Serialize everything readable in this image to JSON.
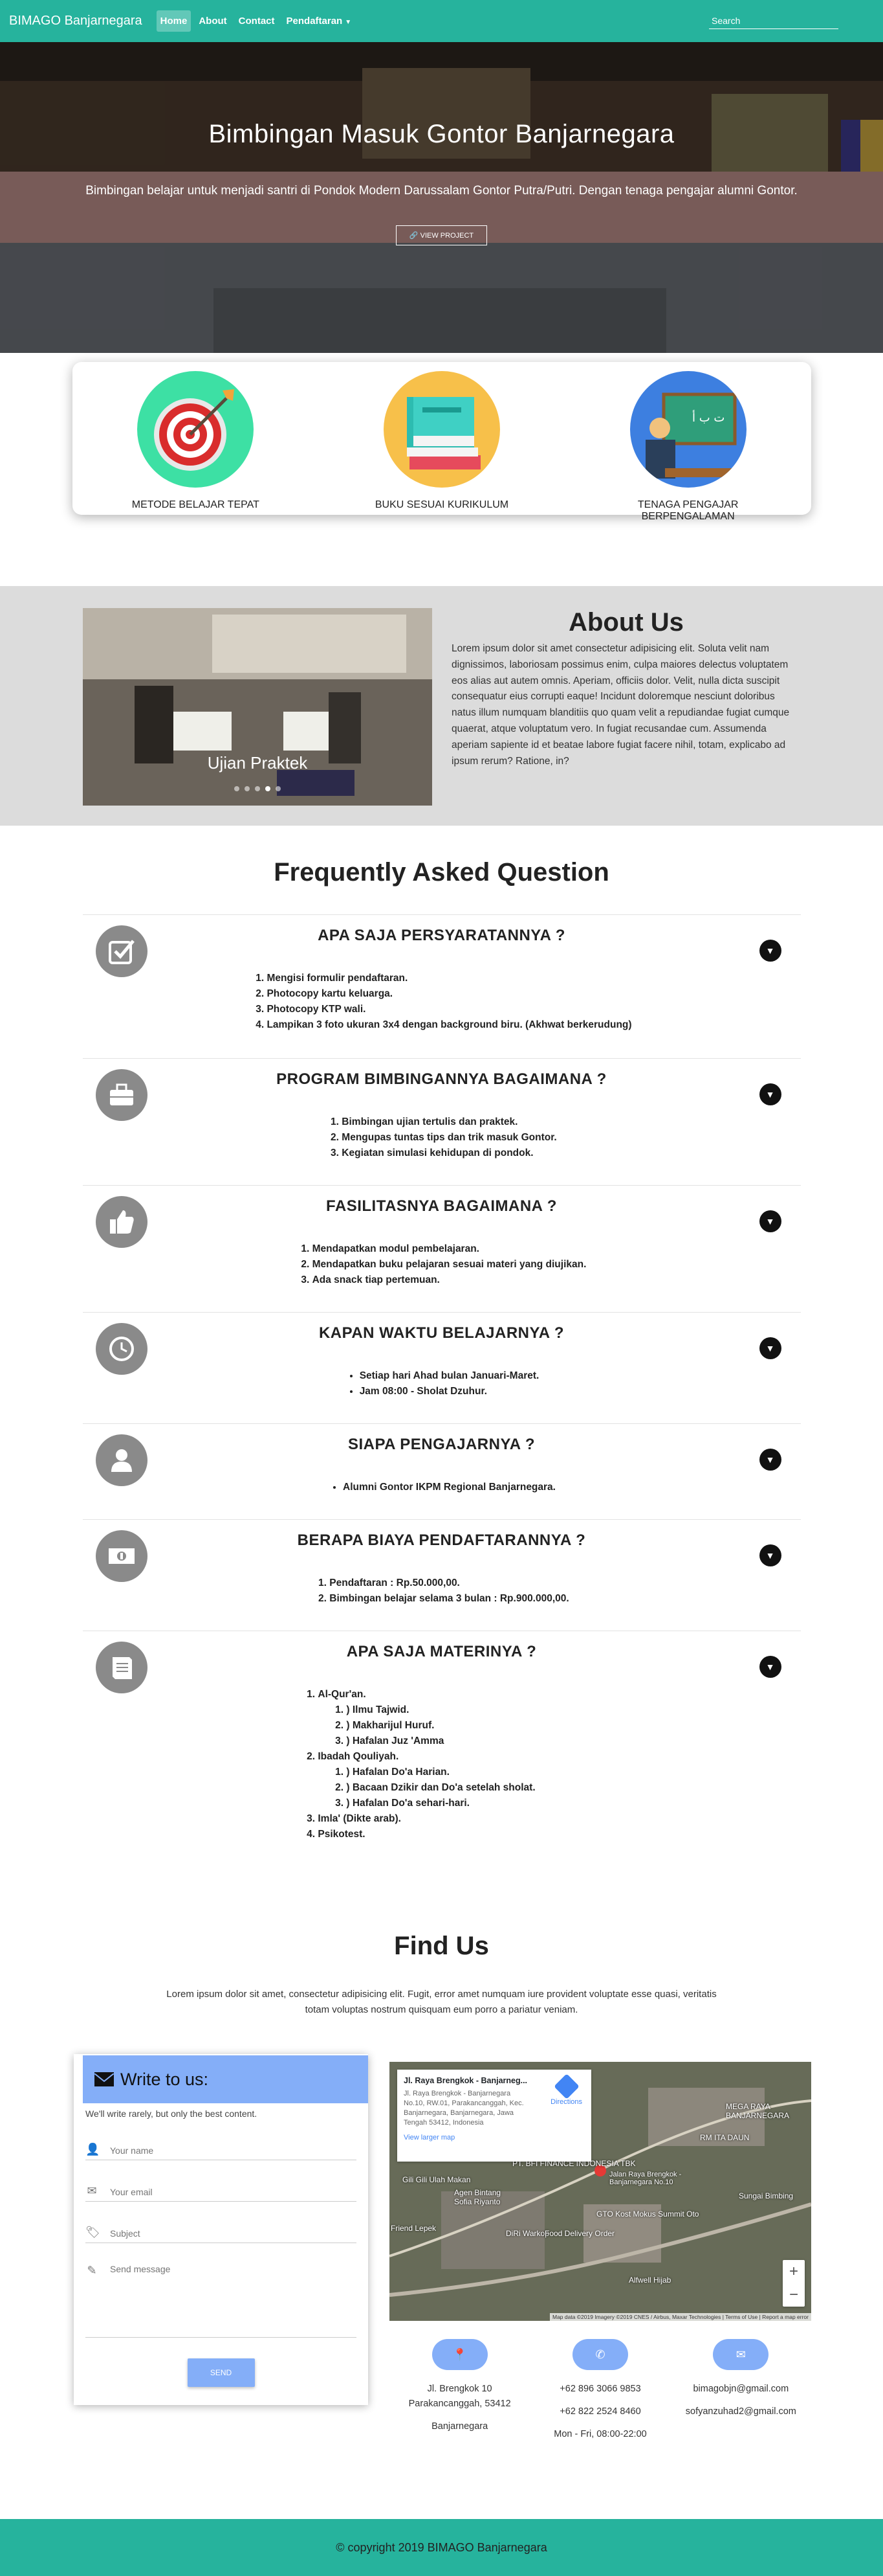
{
  "nav": {
    "brand": "BIMAGO Banjarnegara",
    "items": [
      "Home",
      "About",
      "Contact",
      "Pendaftaran"
    ],
    "search_placeholder": "Search"
  },
  "hero": {
    "title": "Bimbingan Masuk Gontor Banjarnegara",
    "subtitle": "Bimbingan belajar untuk menjadi santri di Pondok Modern Darussalam Gontor Putra/Putri. Dengan tenaga pengajar alumni Gontor.",
    "button": "VIEW PROJECT"
  },
  "features": [
    {
      "label": "METODE BELAJAR TEPAT",
      "icon": "target-icon",
      "color": "#3de0a4"
    },
    {
      "label": "BUKU SESUAI KURIKULUM",
      "icon": "books-icon",
      "color": "#f7c04a"
    },
    {
      "label": "TENAGA PENGAJAR BERPENGALAMAN",
      "icon": "teacher-icon",
      "color": "#3d7fe0"
    }
  ],
  "about": {
    "title": "About Us",
    "body": "Lorem ipsum dolor sit amet consectetur adipisicing elit. Soluta velit nam dignissimos, laboriosam possimus enim, culpa maiores delectus voluptatem eos alias aut autem omnis. Aperiam, officiis dolor. Velit, nulla dicta suscipit consequatur eius corrupti eaque! Incidunt doloremque nesciunt doloribus natus illum numquam blanditiis quo quam velit a repudiandae fugiat cumque quaerat, atque voluptatum vero. In fugiat recusandae cum. Assumenda aperiam sapiente id et beatae labore fugiat facere nihil, totam, explicabo ad ipsum rerum? Ratione, in?",
    "carousel_caption": "Ujian Praktek",
    "carousel_slides": 5,
    "carousel_active": 4
  },
  "faq": {
    "title": "Frequently Asked Question",
    "items": [
      {
        "q": "APA SAJA PERSYARATANNYA ?",
        "icon": "checkbox-icon",
        "list": "ol",
        "a": [
          "Mengisi formulir pendaftaran.",
          "Photocopy kartu keluarga.",
          "Photocopy KTP wali.",
          "Lampikan 3 foto ukuran 3x4 dengan background biru. (Akhwat berkerudung)"
        ]
      },
      {
        "q": "PROGRAM BIMBINGANNYA BAGAIMANA ?",
        "icon": "briefcase-icon",
        "list": "ol",
        "a": [
          "Bimbingan ujian tertulis dan praktek.",
          "Mengupas tuntas tips dan trik masuk Gontor.",
          "Kegiatan simulasi kehidupan di pondok."
        ]
      },
      {
        "q": "FASILITASNYA BAGAIMANA ?",
        "icon": "thumbs-up-icon",
        "list": "ol",
        "a": [
          "Mendapatkan modul pembelajaran.",
          "Mendapatkan buku pelajaran sesuai materi yang diujikan.",
          "Ada snack tiap pertemuan."
        ]
      },
      {
        "q": "KAPAN WAKTU BELAJARNYA ?",
        "icon": "clock-icon",
        "list": "ul",
        "a": [
          "Setiap hari Ahad bulan Januari-Maret.",
          "Jam 08:00 - Sholat Dzuhur."
        ]
      },
      {
        "q": "SIAPA PENGAJARNYA ?",
        "icon": "user-icon",
        "list": "ul",
        "a": [
          "Alumni Gontor IKPM Regional Banjarnegara."
        ]
      },
      {
        "q": "BERAPA BIAYA PENDAFTARANNYA ?",
        "icon": "money-icon",
        "list": "ol",
        "a": [
          "Pendaftaran : Rp.50.000,00.",
          "Bimbingan belajar selama 3 bulan : Rp.900.000,00."
        ]
      },
      {
        "q": "APA SAJA MATERINYA ?",
        "icon": "book-icon",
        "list": "nested",
        "a": [
          {
            "text": "Al-Qur'an.",
            "sub": [
              ") Ilmu Tajwid.",
              ") Makharijul Huruf.",
              ") Hafalan Juz 'Amma"
            ]
          },
          {
            "text": "Ibadah Qouliyah.",
            "sub": [
              ") Hafalan Do'a Harian.",
              ") Bacaan Dzikir dan Do'a setelah sholat.",
              ") Hafalan Do'a sehari-hari."
            ]
          },
          {
            "text": "Imla' (Dikte arab).",
            "sub": []
          },
          {
            "text": "Psikotest.",
            "sub": []
          }
        ]
      }
    ]
  },
  "findus": {
    "title": "Find Us",
    "desc": "Lorem ipsum dolor sit amet, consectetur adipisicing elit. Fugit, error amet numquam iure provident voluptate esse quasi, veritatis totam voluptas nostrum quisquam eum porro a pariatur veniam.",
    "form": {
      "header": "Write to us:",
      "note": "We'll write rarely, but only the best content.",
      "name_placeholder": "Your name",
      "email_placeholder": "Your email",
      "subject_placeholder": "Subject",
      "message_placeholder": "Send message",
      "send": "SEND"
    },
    "map": {
      "card_title": "Jl. Raya Brengkok - Banjarneg...",
      "card_addr": "Jl. Raya Brengkok - Banjarnegara No.10, RW.01, Parakancanggah, Kec. Banjarnegara, Banjarnegara, Jawa Tengah 53412, Indonesia",
      "directions": "Directions",
      "larger": "View larger map",
      "attribution": "Map data ©2019 Imagery ©2019 CNES / Airbus, Maxar Technologies  |  Terms of Use  |  Report a map error",
      "labels": [
        "MEGA RAYA BANJARNEGARA",
        "RM ITA DAUN",
        "PT. BFI FINANCE INDONESIA TBK",
        "Jalan Raya Brengkok - Banjarnegara No.10",
        "Gili Gili Ulah Makan",
        "Agen Bintang Sofia Riyanto",
        "DiRi Warkop",
        "Friend Lepek",
        "Food Delivery Order",
        "GTO Kost Mokus Summit Oto",
        "Sungai Bimbing",
        "Alfwell Hijab"
      ]
    },
    "info": {
      "address": [
        "Jl. Brengkok 10",
        "Parakancanggah, 53412",
        "Banjarnegara"
      ],
      "phones": [
        "+62 896 3066 9853",
        "+62 822 2524 8460",
        "Mon - Fri, 08:00-22:00"
      ],
      "emails": [
        "bimagobjn@gmail.com",
        "sofyanzuhad2@gmail.com"
      ]
    }
  },
  "footer": {
    "text": "© copyright 2019 BIMAGO Banjarnegara"
  },
  "colors": {
    "primary": "#26b39d",
    "accent": "#84aef8"
  }
}
